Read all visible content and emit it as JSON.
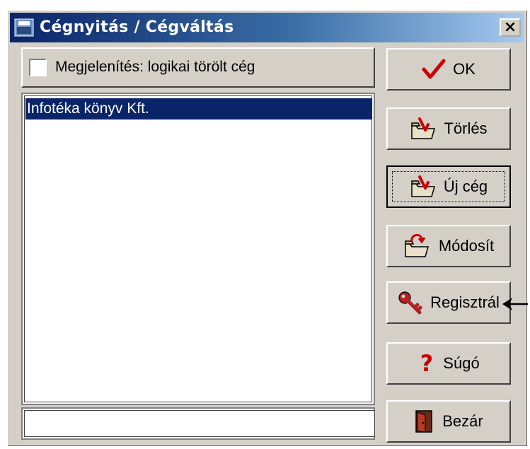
{
  "window": {
    "title": "Cégnyitás / Cégváltás",
    "close_glyph": "×",
    "title_gradient": [
      "#0a246a",
      "#a6caf0"
    ]
  },
  "options": {
    "show_deleted_label": "Megjelenítés: logikai törölt cég",
    "show_deleted_checked": false
  },
  "company_list": {
    "items": [
      "Infotéka könyv Kft."
    ],
    "selected_index": 0,
    "selection_color": "#0a246a"
  },
  "filter_field": {
    "value": "",
    "placeholder": ""
  },
  "buttons": {
    "ok": {
      "label": "OK",
      "icon": "checkmark-icon"
    },
    "delete": {
      "label": "Törlés",
      "icon": "folder-delete-icon"
    },
    "new": {
      "label": "Új cég",
      "icon": "folder-new-icon",
      "focused": true
    },
    "modify": {
      "label": "Módosít",
      "icon": "folder-modify-icon"
    },
    "register": {
      "label": "Regisztrál",
      "icon": "key-icon"
    },
    "help": {
      "label": "Súgó",
      "icon": "question-icon"
    },
    "close": {
      "label": "Bezár",
      "icon": "door-icon"
    }
  },
  "annotation": {
    "icon": "pointer-arrow-icon"
  }
}
